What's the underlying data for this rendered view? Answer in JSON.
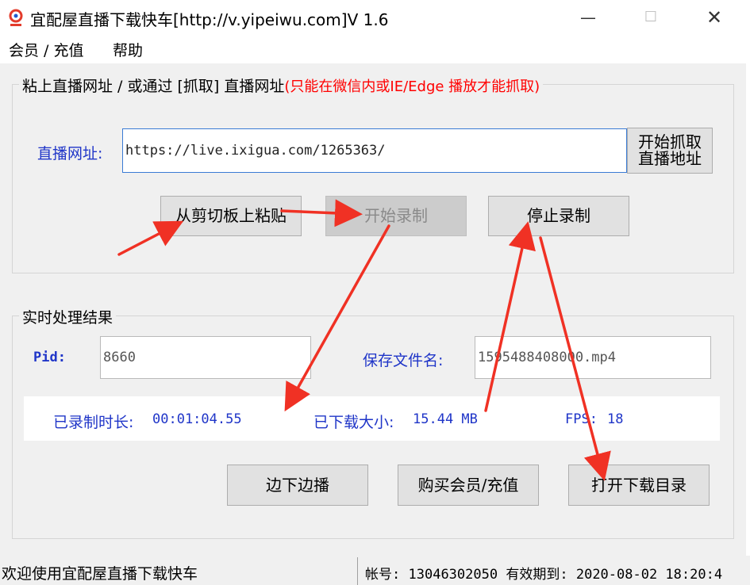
{
  "window": {
    "title": "宜配屋直播下载快车[http://v.yipeiwu.com]V 1.6",
    "minimize_glyph": "—",
    "maximize_glyph": "☐",
    "close_glyph": "✕"
  },
  "menu": {
    "items": [
      "会员 / 充值",
      "帮助"
    ]
  },
  "url_group": {
    "title_main": "粘上直播网址 / 或通过 [抓取] 直播网址",
    "title_note": "(只能在微信内或IE/Edge 播放才能抓取)",
    "url_label": "直播网址:",
    "url_value": "https://live.ixigua.com/1265363/",
    "grab_button_line1": "开始抓取",
    "grab_button_line2": "直播地址",
    "paste_button": "从剪切板上粘贴",
    "start_button": "开始录制",
    "stop_button": "停止录制"
  },
  "result_group": {
    "title": "实时处理结果",
    "pid_label": "Pid:",
    "pid_value": "8660",
    "filename_label": "保存文件名:",
    "filename_value": "1595488408000.mp4",
    "duration_label": "已录制时长:",
    "duration_value": "00:01:04.55",
    "size_label": "已下载大小:",
    "size_value": "15.44 MB",
    "fps_label": "FPS:",
    "fps_value": "18",
    "play_button": "边下边播",
    "buy_button": "购买会员/充值",
    "open_dir_button": "打开下载目录"
  },
  "status": {
    "welcome": "欢迎使用宜配屋直播下载快车",
    "account_label": "帐号:",
    "account_value": "13046302050",
    "expiry_label": "有效期到:",
    "expiry_value": "2020-08-02 18:20:4"
  },
  "colors": {
    "accent_blue": "#1f35c8",
    "note_red": "#ff0000",
    "arrow_red": "#f03124"
  }
}
